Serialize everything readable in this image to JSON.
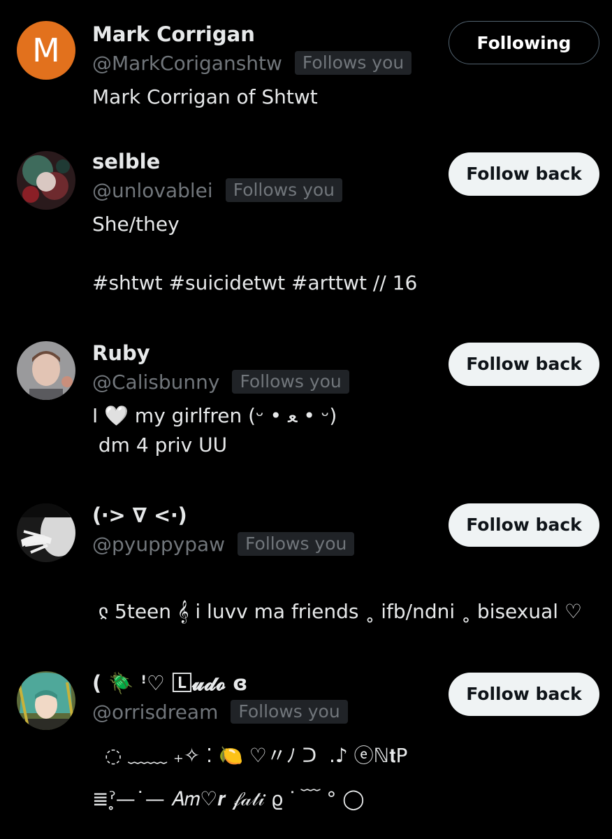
{
  "users": [
    {
      "avatar_letter": "M",
      "name": "Mark Corrigan",
      "handle": "@MarkCoriganshtw",
      "badge": "Follows you",
      "bio": "Mark Corrigan of Shtwt",
      "button": "Following"
    },
    {
      "name": "selble",
      "handle": "@unlovablei",
      "badge": "Follows you",
      "bio": "She/they\n\n#shtwt #suicidetwt #arttwt // 16",
      "button": "Follow back"
    },
    {
      "name": "Ruby",
      "handle": "@Calisbunny",
      "badge": "Follows you",
      "bio": "I 🤍 my girlfren (ᵕ • ﻌ • ᵕ)\n dm 4 priv ᑌᑌ",
      "button": "Follow back"
    },
    {
      "name": "(‧> ∇ <‧)",
      "handle": "@pyuppypaw",
      "badge": "Follows you",
      "bio": "\n ჺ 5teen 𝄞 i luvv ma friends ˳ ifb/ndni ˳ bisexual ♡",
      "button": "Follow back"
    },
    {
      "name": "( 🪲 ꜝ♡ 🄻𝓾𝓭𝓸 ɞ",
      "handle": "@orrisdream",
      "badge": "Follows you",
      "bio": "  ◌ ﹏﹏ ₊✧ ⁚ 🍋 ♡〃ﾉ ᑐ  .♪ ⓔℕ𝐭P\n≣ˀ̥—˙— 𝐴𝑚♡𝒓 𝒻𝒶𝓉𝒾 ϱ ᐝ ﹋ ° ◯",
      "button": "Follow back"
    }
  ],
  "colors": {
    "background": "#000000",
    "primary_text": "#e7e9ea",
    "secondary_text": "#71767b",
    "badge_bg": "#202327",
    "avatar_letter_bg": "#e2711d",
    "follow_back_bg": "#eff3f4"
  }
}
